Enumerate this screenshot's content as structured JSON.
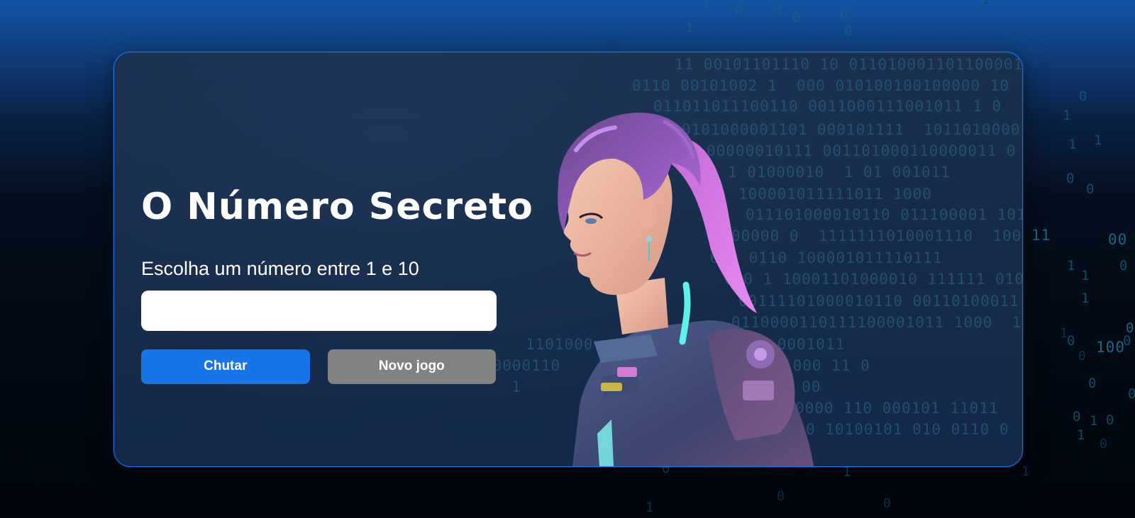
{
  "game": {
    "title": "O Número Secreto",
    "instruction": "Escolha um número entre 1 e 10",
    "input": {
      "value": "",
      "placeholder": ""
    },
    "buttons": {
      "guess_label": "Chutar",
      "new_game_label": "Novo jogo"
    }
  },
  "background_code": {
    "outer": [
      "1",
      "0",
      "1",
      "0",
      "0",
      "1",
      "0",
      "0",
      "1",
      "0",
      "1",
      "1",
      "1",
      "0",
      "1",
      "0",
      "1",
      "1",
      "0",
      "0",
      "1",
      "0",
      "1",
      "1",
      "1",
      "0",
      "0",
      "1",
      "0",
      "0",
      "0",
      "0",
      "0",
      "1",
      "0",
      "0",
      "1",
      "0",
      "0",
      "11",
      "100",
      "00"
    ],
    "card": [
      "11 00101101110 10 011010001101100001",
      "0110 00101002 1  000 010100100100000 10",
      "011011011100110 0011000111001011 1 0",
      "0101000001101 000101111  1011010000 10",
      "00000010111 001101000110000011 0 0",
      "1 01000010  1 01 001011         001011",
      "100001011111011 1000                1 0",
      "011101000010110 011100001 10101",
      "00000 0  1111111010001110  100100011",
      "0 1 0110 100001011110111",
      "000 1 10001101000010 111111 01000",
      "00111101000010110 00110100011 0",
      "0110000110111100001011 1000  1010",
      "1101000  10 11 10 1011 10 0001011",
      "10000110        0001100000111101000 11 0",
      "1                00101100010  00",
      "0000 110 000101 11011",
      "0 10100101 010 0110 0"
    ]
  },
  "colors": {
    "accent": "#1875e8",
    "secondary_button": "#828282",
    "card_background": "#172b48",
    "page_background_top": "#1354a3",
    "page_background_bottom": "#01060d"
  }
}
